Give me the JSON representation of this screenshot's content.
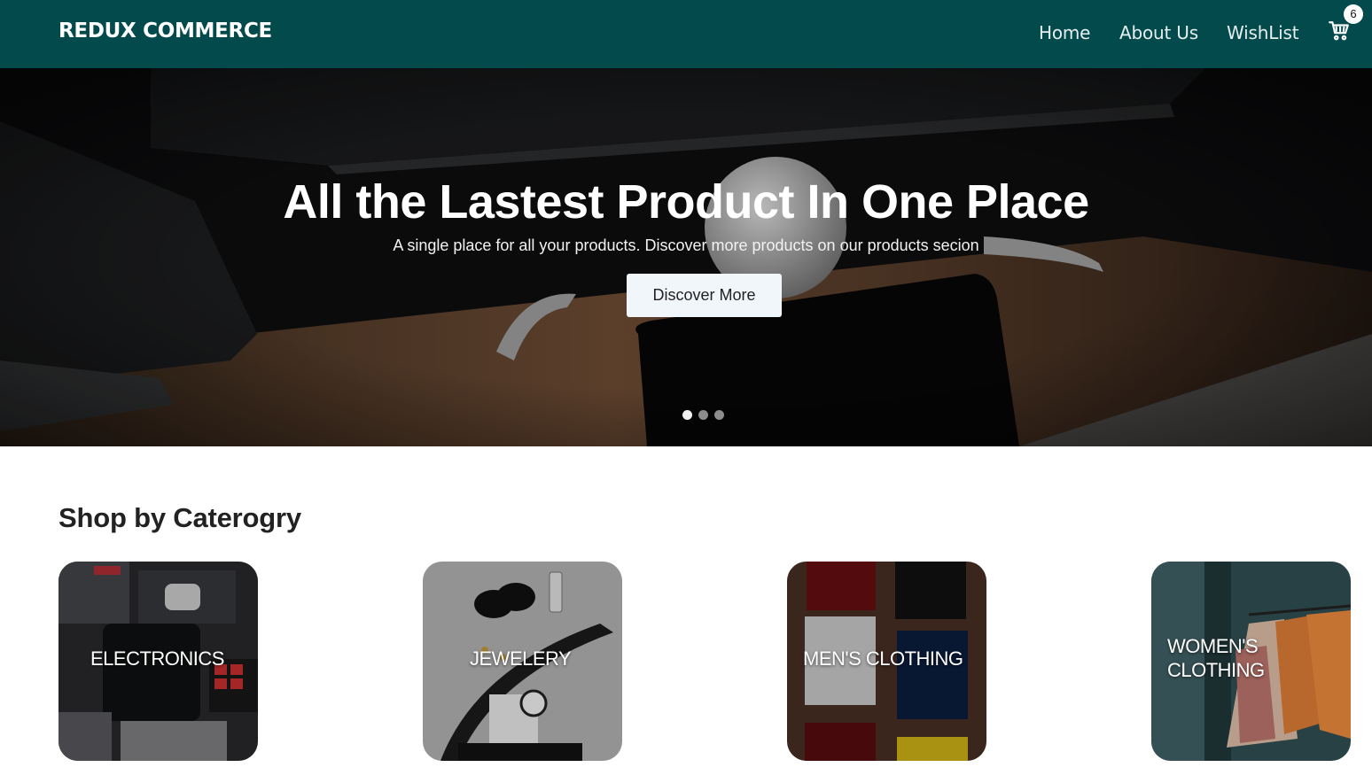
{
  "navbar": {
    "brand": "REDUX COMMERCE",
    "links": [
      "Home",
      "About Us",
      "WishList"
    ],
    "cart_icon": "shopping-cart-icon",
    "cart_count": "6",
    "background": "#034a4d"
  },
  "hero": {
    "title": "All the Lastest Product In One Place",
    "subtitle": "A single place for all your products. Discover more products on our products secion",
    "cta_label": "Discover More",
    "slide_count": 3,
    "active_slide": 1
  },
  "categories": {
    "title": "Shop by Caterogry",
    "items": [
      {
        "label": "ELECTRONICS"
      },
      {
        "label": "JEWELERY"
      },
      {
        "label": "MEN'S CLOTHING"
      },
      {
        "label_line1": "WOMEN'S",
        "label_line2": "CLOTHING"
      }
    ]
  }
}
